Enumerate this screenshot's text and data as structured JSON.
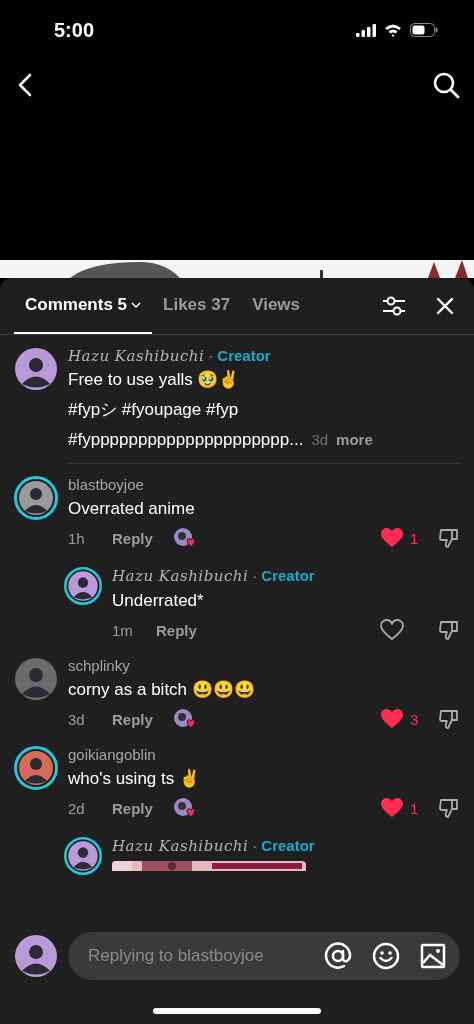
{
  "status_bar": {
    "time": "5:00"
  },
  "tabs": [
    {
      "label": "Comments 5",
      "selected": true,
      "dropdown": true
    },
    {
      "label": "Likes 37",
      "selected": false,
      "dropdown": false
    },
    {
      "label": "Views",
      "selected": false,
      "dropdown": false
    }
  ],
  "comments": [
    {
      "kind": "caption",
      "author": "Hazu Kashibuchi",
      "creator": true,
      "separator": "·",
      "badge": "Creator",
      "story_ring": false,
      "color": "#b89ad8",
      "lines": [
        "Free to use yalls 🥹✌️",
        "#fypシ #fyoupage #fyp"
      ],
      "last_line": "#fyppppppppppppppppppppp...",
      "time": "3d",
      "more": "more"
    },
    {
      "kind": "comment",
      "author": "blastboyjoe",
      "creator": false,
      "story_ring": true,
      "color": "#9a9a9a",
      "text": "Overrated anime",
      "time": "1h",
      "reply": "Reply",
      "creator_liked": true,
      "liked": true,
      "likes": "1",
      "children": [
        {
          "kind": "comment",
          "author": "Hazu Kashibuchi",
          "creator": true,
          "separator": "·",
          "badge": "Creator",
          "story_ring": true,
          "color": "#b89ad8",
          "text": "Underrated*",
          "time": "1m",
          "reply": "Reply",
          "creator_liked": false,
          "liked": false
        }
      ]
    },
    {
      "kind": "comment",
      "author": "schplinky",
      "creator": false,
      "story_ring": false,
      "color": "#6a6a6a",
      "text": "corny as a bitch 😃😃😃",
      "time": "3d",
      "reply": "Reply",
      "creator_liked": true,
      "liked": true,
      "likes": "3"
    },
    {
      "kind": "comment",
      "author": "goikiangoblin",
      "creator": false,
      "story_ring": true,
      "color": "#d86a5a",
      "text": "who's using ts ✌️",
      "time": "2d",
      "reply": "Reply",
      "creator_liked": true,
      "liked": true,
      "likes": "1",
      "children": [
        {
          "kind": "attachment",
          "author": "Hazu Kashibuchi",
          "creator": true,
          "separator": "·",
          "badge": "Creator",
          "story_ring": true,
          "color": "#b89ad8"
        }
      ]
    }
  ],
  "composer": {
    "placeholder": "Replying to blastboyjoe",
    "color": "#b89ad8"
  }
}
